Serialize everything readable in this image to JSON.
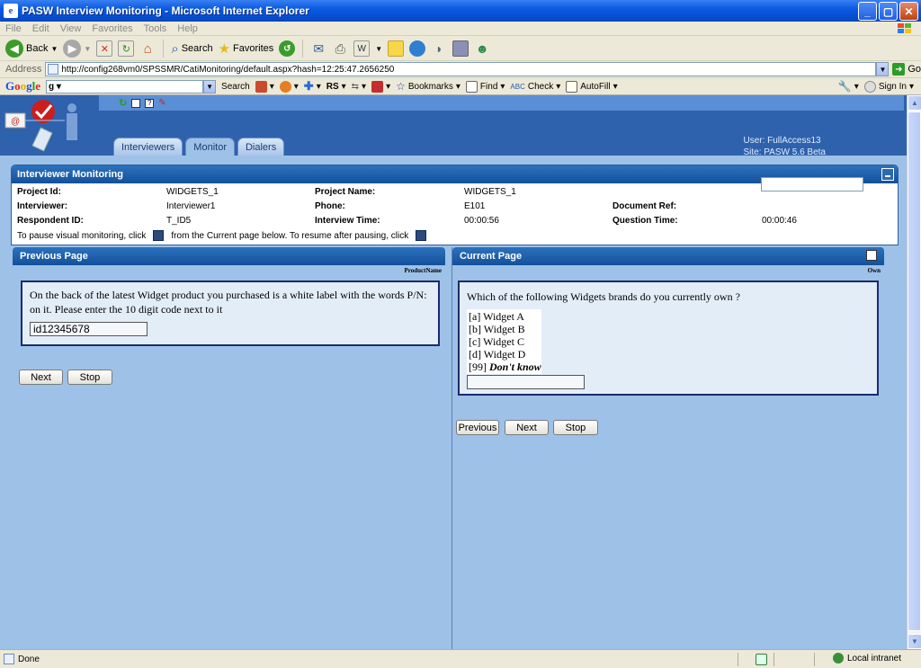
{
  "window": {
    "title": "PASW Interview Monitoring - Microsoft Internet Explorer"
  },
  "menu": [
    "File",
    "Edit",
    "View",
    "Favorites",
    "Tools",
    "Help"
  ],
  "toolbar": {
    "back": "Back",
    "search": "Search",
    "favorites": "Favorites"
  },
  "address": {
    "label": "Address",
    "url": "http://config268vm0/SPSSMR/CatiMonitoring/default.aspx?hash=12:25:47.2656250",
    "go": "Go"
  },
  "google_toolbar": {
    "search": "Search",
    "rs": "RS",
    "bookmarks": "Bookmarks",
    "find": "Find",
    "check": "Check",
    "autofill": "AutoFill",
    "signin": "Sign In"
  },
  "app": {
    "tabs": [
      "Interviewers",
      "Monitor",
      "Dialers"
    ],
    "active_tab": "Monitor",
    "user": "User: FullAccess13",
    "site": "Site: PASW 5.6 Beta"
  },
  "monitoring": {
    "title": "Interviewer Monitoring",
    "project_id_label": "Project Id:",
    "project_id": "WIDGETS_1",
    "project_name_label": "Project Name:",
    "project_name": "WIDGETS_1",
    "interviewer_label": "Interviewer:",
    "interviewer": "Interviewer1",
    "phone_label": "Phone:",
    "phone": "E101",
    "document_ref_label": "Document Ref:",
    "document_ref": "",
    "respondent_label": "Respondent ID:",
    "respondent": "T_ID5",
    "interview_time_label": "Interview Time:",
    "interview_time": "00:00:56",
    "question_time_label": "Question Time:",
    "question_time": "00:00:46",
    "pause_text_1": "To pause visual monitoring, click",
    "pause_text_2": "from the Current page below. To resume after pausing, click"
  },
  "previous_page": {
    "title": "Previous Page",
    "var_name": "ProductName",
    "question": "On the back of the latest Widget product you purchased is a white label with the words P/N: on it. Please enter the 10 digit code next to it",
    "answer": "id12345678",
    "next": "Next",
    "stop": "Stop"
  },
  "current_page": {
    "title": "Current Page",
    "var_name": "Own",
    "question": "Which of the following Widgets brands do you currently own ?",
    "options": [
      "[a] Widget A",
      "[b] Widget B",
      "[c] Widget C",
      "[d] Widget D"
    ],
    "dont_know_code": "[99]",
    "dont_know_label": "Don't know",
    "answer": "",
    "previous": "Previous",
    "next": "Next",
    "stop": "Stop"
  },
  "status": {
    "text": "Done",
    "zone": "Local intranet"
  }
}
